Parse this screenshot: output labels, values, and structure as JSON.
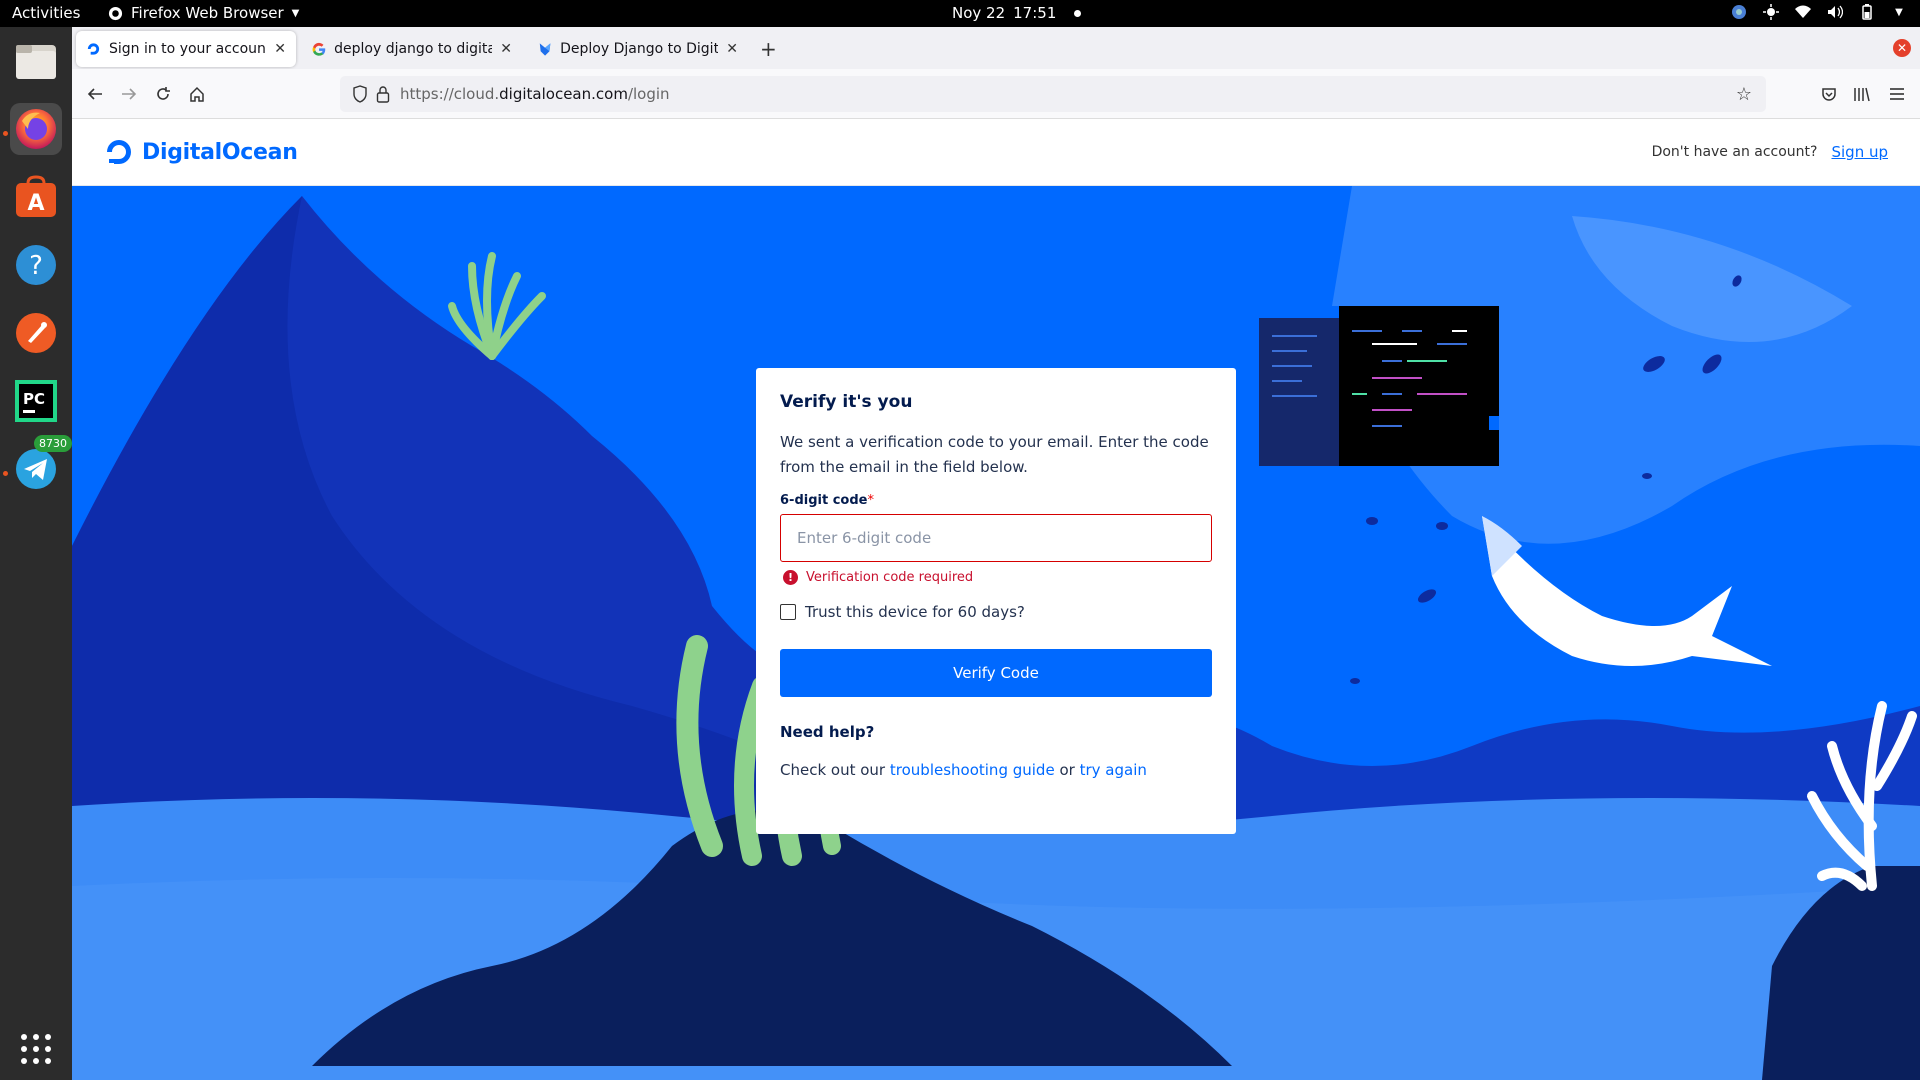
{
  "topbar": {
    "activities": "Activities",
    "app_name": "Firefox Web Browser",
    "date": "Noy 22",
    "time": "17:51"
  },
  "dock": {
    "telegram_badge": "8730",
    "items": [
      "files-icon",
      "firefox-icon",
      "software-icon",
      "help-icon",
      "postman-icon",
      "pycharm-icon",
      "telegram-icon",
      "app-grid-icon"
    ]
  },
  "browser": {
    "tabs": [
      {
        "title": "Sign in to your account | D"
      },
      {
        "title": "deploy django to digitalo"
      },
      {
        "title": "Deploy Django to Digital"
      }
    ],
    "url_prefix": "https://cloud.",
    "url_domain": "digitalocean.com",
    "url_path": "/login"
  },
  "site": {
    "brand": "DigitalOcean",
    "no_account": "Don't have an account?",
    "signup": "Sign up"
  },
  "card": {
    "title": "Verify it's you",
    "description": "We sent a verification code to your email. Enter the code from the email in the field below.",
    "code_label": "6-digit code",
    "required_mark": "*",
    "code_placeholder": "Enter 6-digit code",
    "error": "Verification code required",
    "trust_label": "Trust this device for 60 days?",
    "verify_button": "Verify Code",
    "help_heading": "Need help?",
    "help_prefix": "Check out our",
    "help_link1": "troubleshooting guide",
    "help_mid": "or",
    "help_link2": "try again"
  },
  "colors": {
    "brand_blue": "#0069ff",
    "error_red": "#d50000",
    "ocean_light": "#3d8cf7",
    "ocean_deep": "#0a2a8c"
  }
}
